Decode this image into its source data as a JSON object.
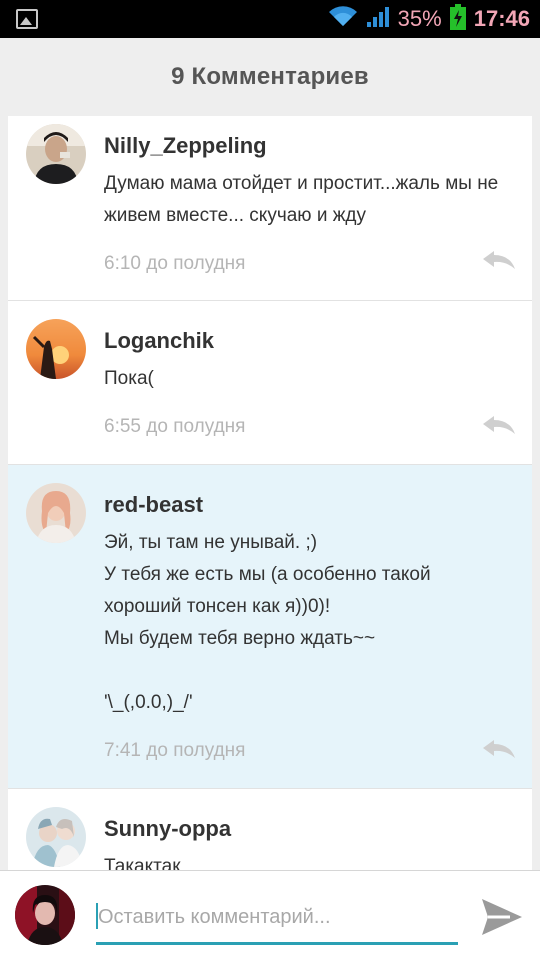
{
  "status_bar": {
    "battery_percent": "35%",
    "time": "17:46"
  },
  "header": {
    "title": "9 Комментариев"
  },
  "comments": [
    {
      "author": "Nilly_Zeppeling",
      "text": "Думаю мама отойдет и простит...жаль мы не живем вместе... скучаю и жду",
      "time": "6:10 до полудня"
    },
    {
      "author": "Loganchik",
      "text": "Пока(",
      "time": "6:55 до полудня"
    },
    {
      "author": "red-beast",
      "text": "Эй, ты там не унывай. ;)\nУ тебя же есть мы (а особенно такой хороший тонсен как я))0)!\nМы будем тебя верно ждать~~\n\n'\\_(,0.0,)_/'",
      "time": "7:41 до полудня"
    },
    {
      "author": "Sunny-oppa",
      "text": "Такактак",
      "time": ""
    }
  ],
  "composer": {
    "placeholder": "Оставить комментарий...",
    "value": ""
  },
  "icons": {
    "reply": "reply-icon",
    "send": "send-icon",
    "wifi": "wifi-icon",
    "signal": "signal-icon",
    "battery": "battery-charging-icon",
    "gallery": "image-notification-icon"
  },
  "colors": {
    "accent": "#2aa0b4",
    "highlight_bg": "#e6f4fa",
    "status_text": "#f2a6b6"
  }
}
